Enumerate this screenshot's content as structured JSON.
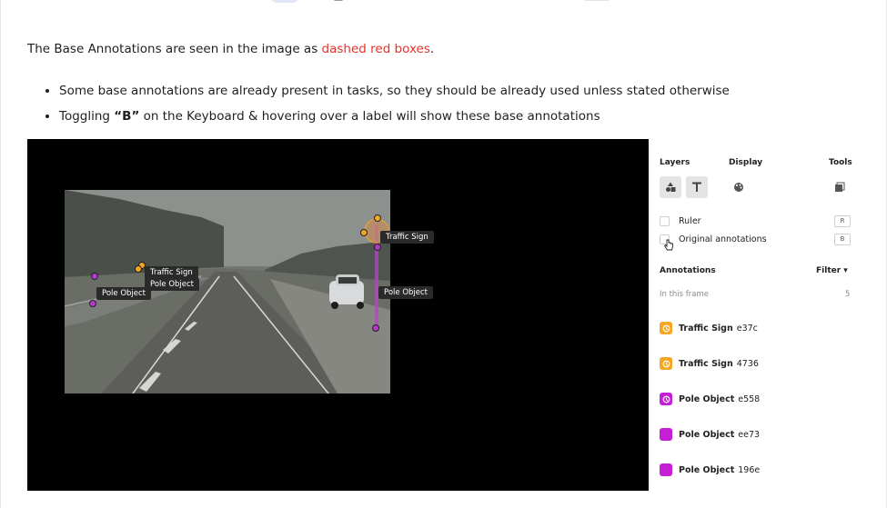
{
  "intro": {
    "prefix": "The Base Annotations are seen in the image as ",
    "highlight": "dashed red boxes",
    "suffix": ".",
    "highlight_color": "#e8312b"
  },
  "bullets": {
    "item1": "Some base annotations are already present in tasks, so they should be already used unless stated otherwise",
    "item2_prefix": "Toggling ",
    "item2_key": "“B”",
    "item2_suffix": " on the Keyboard & hovering over a label will show these base annotations"
  },
  "scene": {
    "labels": [
      "Traffic Sign",
      "Pole Object",
      "Traffic Sign",
      "Pole Object",
      "Pole Object"
    ]
  },
  "panel": {
    "headers": {
      "layers": "Layers",
      "display": "Display",
      "tools": "Tools"
    },
    "layer_buttons": [
      "shapes-icon",
      "text-icon"
    ],
    "display_icon": "palette-icon",
    "tools_icon": "copy-icon",
    "toggles": [
      {
        "label": "Ruler",
        "key": "R"
      },
      {
        "label": "Original annotations",
        "key": "B"
      }
    ],
    "annotations_header": "Annotations",
    "filter_label": "Filter ▾",
    "in_frame_label": "In this frame",
    "in_frame_count": "5",
    "annotations": [
      {
        "name": "Traffic Sign",
        "id": "e37c",
        "color": "#f5a623",
        "icon": "history-icon"
      },
      {
        "name": "Traffic Sign",
        "id": "4736",
        "color": "#f5a623",
        "icon": "history-icon"
      },
      {
        "name": "Pole Object",
        "id": "e558",
        "color": "#c41fd6",
        "icon": "history-icon"
      },
      {
        "name": "Pole Object",
        "id": "ee73",
        "color": "#c41fd6",
        "icon": ""
      },
      {
        "name": "Pole Object",
        "id": "196e",
        "color": "#c41fd6",
        "icon": ""
      }
    ]
  }
}
